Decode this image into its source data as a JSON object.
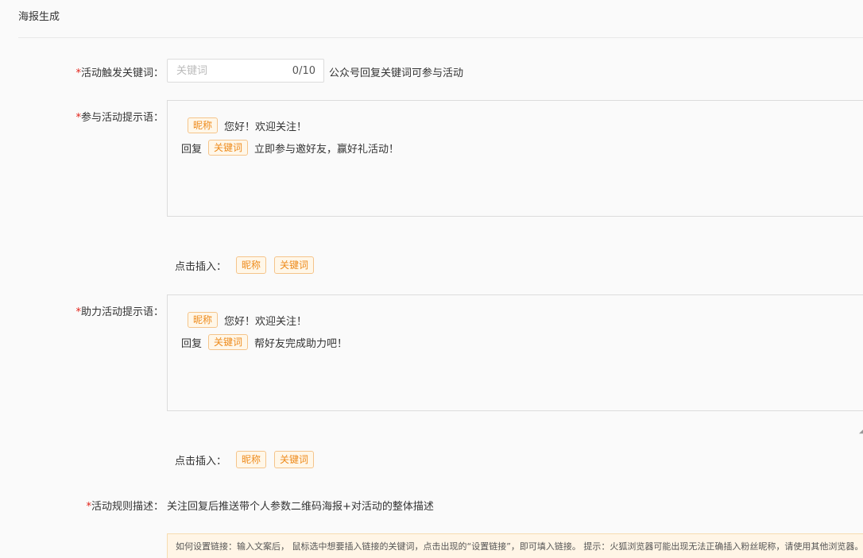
{
  "page": {
    "title": "海报生成"
  },
  "keyword_field": {
    "label": "活动触发关键词：",
    "required_mark": "*",
    "placeholder": "关键词",
    "value": "",
    "counter": "0/10",
    "hint": "公众号回复关键词可参与活动"
  },
  "join_prompt": {
    "label": "参与活动提示语：",
    "required_mark": "*",
    "line1_tag": "昵称",
    "line1_text": "您好！欢迎关注！",
    "line2_prefix": "回复",
    "line2_tag": "关键词",
    "line2_text": "立即参与邀好友，赢好礼活动！",
    "insert_label": "点击插入：",
    "insert_tags": [
      "昵称",
      "关键词"
    ]
  },
  "assist_prompt": {
    "label": "助力活动提示语：",
    "required_mark": "*",
    "line1_tag": "昵称",
    "line1_text": "您好！欢迎关注！",
    "line2_prefix": "回复",
    "line2_tag": "关键词",
    "line2_text": "帮好友完成助力吧！",
    "insert_label": "点击插入：",
    "insert_tags": [
      "昵称",
      "关键词"
    ]
  },
  "rules": {
    "label": "活动规则描述：",
    "required_mark": "*",
    "text": "关注回复后推送带个人参数二维码海报+对活动的整体描述"
  },
  "notice": {
    "text": "如何设置链接：输入文案后， 鼠标选中想要插入链接的关键词，点击出现的“设置链接”，即可填入链接。 提示：火狐浏览器可能出现无法正确插入粉丝昵称，请使用其他浏览器。"
  }
}
